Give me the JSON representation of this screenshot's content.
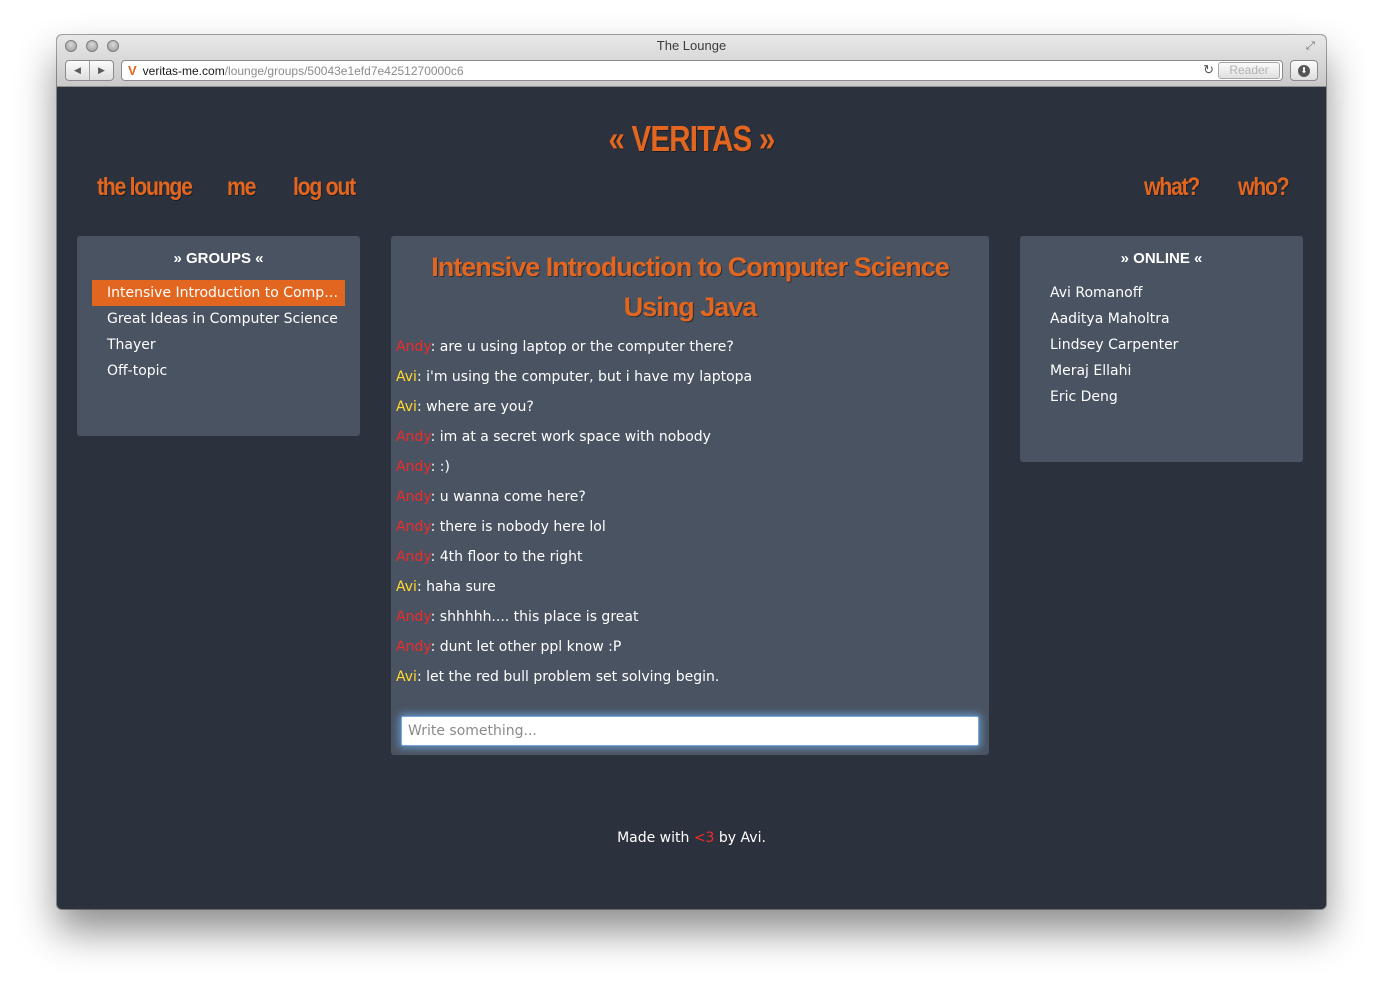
{
  "browser": {
    "window_title": "The Lounge",
    "url_host": "veritas-me.com",
    "url_path": "/lounge/groups/50043e1efd7e4251270000c6",
    "reader_label": "Reader",
    "back_glyph": "◀",
    "forward_glyph": "▶",
    "reload_glyph": "↻",
    "fullscreen_glyph": "⤢",
    "download_glyph": "⬇",
    "favicon_glyph": "V"
  },
  "header": {
    "brand": "« VERITAS »",
    "nav_left": [
      "the lounge",
      "me",
      "log out"
    ],
    "nav_right": [
      "what?",
      "who?"
    ]
  },
  "groups": {
    "heading": "» GROUPS «",
    "items": [
      "Intensive Introduction to Computer Science Using Java",
      "Great Ideas in Computer Science",
      "Thayer",
      "Off-topic"
    ],
    "active_index": 0
  },
  "chat": {
    "title": "Intensive Introduction to Computer Science Using Java",
    "messages": [
      {
        "author": "Andy",
        "text": ": are u using laptop or the computer there?"
      },
      {
        "author": "Avi",
        "text": ": i'm using the computer, but i have my laptopa"
      },
      {
        "author": "Avi",
        "text": ": where are you?"
      },
      {
        "author": "Andy",
        "text": ": im at a secret work space with nobody"
      },
      {
        "author": "Andy",
        "text": ": :)"
      },
      {
        "author": "Andy",
        "text": ": u wanna come here?"
      },
      {
        "author": "Andy",
        "text": ": there is nobody here lol"
      },
      {
        "author": "Andy",
        "text": ": 4th floor to the right"
      },
      {
        "author": "Avi",
        "text": ": haha sure"
      },
      {
        "author": "Andy",
        "text": ": shhhhh.... this place is great"
      },
      {
        "author": "Andy",
        "text": ": dunt let other ppl know :P"
      },
      {
        "author": "Avi",
        "text": ": let the red bull problem set solving begin."
      }
    ],
    "input_placeholder": "Write something..."
  },
  "online": {
    "heading": "» ONLINE «",
    "users": [
      "Avi Romanoff",
      "Aaditya Maholtra",
      "Lindsey Carpenter",
      "Meraj Ellahi",
      "Eric Deng"
    ]
  },
  "footer": {
    "prefix": "Made with ",
    "heart": "<3",
    "suffix": " by Avi."
  },
  "colors": {
    "accent": "#e2661f",
    "background": "#2c323d",
    "panel": "#4a5361",
    "andy": "#ef2b2b",
    "avi": "#ffd92e"
  }
}
